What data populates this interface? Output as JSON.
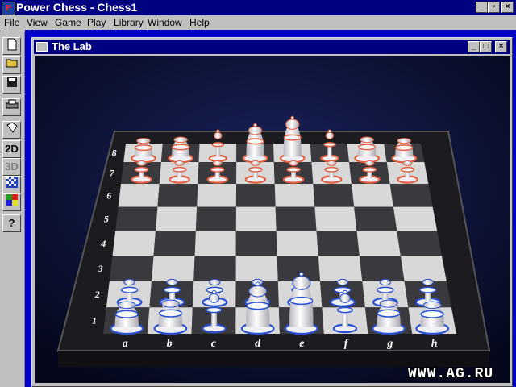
{
  "app": {
    "title": "Power Chess - Chess1",
    "icon": "power-chess-logo"
  },
  "menu": [
    {
      "pre": "",
      "u": "F",
      "post": "ile"
    },
    {
      "pre": "",
      "u": "V",
      "post": "iew"
    },
    {
      "pre": "",
      "u": "G",
      "post": "ame"
    },
    {
      "pre": "",
      "u": "P",
      "post": "lay"
    },
    {
      "pre": "",
      "u": "L",
      "post": "ibrary"
    },
    {
      "pre": "",
      "u": "W",
      "post": "indow"
    },
    {
      "pre": "",
      "u": "H",
      "post": "elp"
    }
  ],
  "toolbar": {
    "tools": [
      "new-file-icon",
      "open-folder-icon",
      "save-disk-icon",
      "print-icon",
      "board-setup-icon",
      "2D",
      "3D",
      "board-pattern-icon",
      "colors-icon",
      "?"
    ]
  },
  "window": {
    "title": "The Lab"
  },
  "board": {
    "ranks": [
      "8",
      "7",
      "6",
      "5",
      "4",
      "3",
      "2",
      "1"
    ],
    "files": [
      "a",
      "b",
      "c",
      "d",
      "e",
      "f",
      "g",
      "h"
    ],
    "colors": {
      "light": "#d8d8d8",
      "dark": "#3a3a3e",
      "frame": "#1a1a1e",
      "background": "#10184a",
      "whiteAccent": "#2850d0",
      "blackAccent": "#e06040"
    },
    "pieces": {
      "black_back": [
        "rook",
        "knight",
        "bishop",
        "queen",
        "king",
        "bishop",
        "knight",
        "rook"
      ],
      "white_back": [
        "rook",
        "knight",
        "bishop",
        "queen",
        "king",
        "bishop",
        "knight",
        "rook"
      ]
    }
  },
  "watermark": "WWW.AG.RU"
}
